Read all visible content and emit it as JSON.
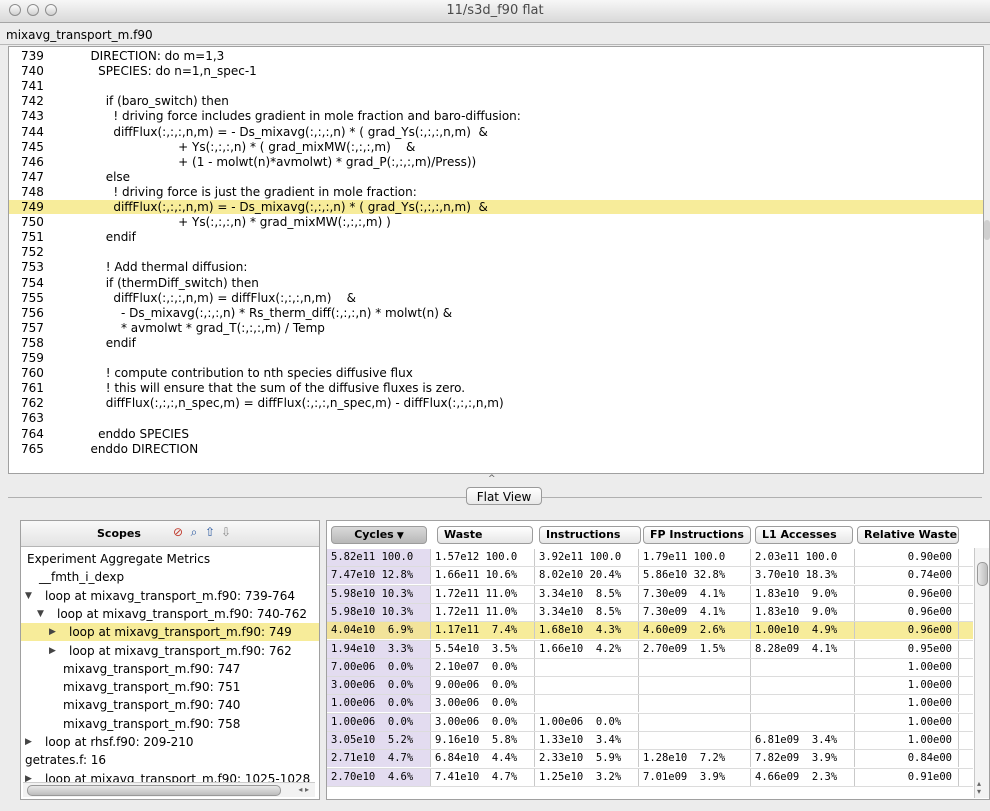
{
  "window": {
    "title": "11/s3d_f90 flat"
  },
  "source": {
    "file_name": "mixavg_transport_m.f90",
    "lines": [
      {
        "num": "739",
        "code": "   DIRECTION: do m=1,3"
      },
      {
        "num": "740",
        "code": "     SPECIES: do n=1,n_spec-1"
      },
      {
        "num": "741",
        "code": ""
      },
      {
        "num": "742",
        "code": "       if (baro_switch) then"
      },
      {
        "num": "743",
        "code": "         ! driving force includes gradient in mole fraction and baro-diffusion:"
      },
      {
        "num": "744",
        "code": "         diffFlux(:,:,:,n,m) = - Ds_mixavg(:,:,:,n) * ( grad_Ys(:,:,:,n,m)  &"
      },
      {
        "num": "745",
        "code": "                          + Ys(:,:,:,n) * ( grad_mixMW(:,:,:,m)    &"
      },
      {
        "num": "746",
        "code": "                          + (1 - molwt(n)*avmolwt) * grad_P(:,:,:,m)/Press))"
      },
      {
        "num": "747",
        "code": "       else"
      },
      {
        "num": "748",
        "code": "         ! driving force is just the gradient in mole fraction:"
      },
      {
        "num": "749",
        "code": "         diffFlux(:,:,:,n,m) = - Ds_mixavg(:,:,:,n) * ( grad_Ys(:,:,:,n,m)  &"
      },
      {
        "num": "750",
        "code": "                          + Ys(:,:,:,n) * grad_mixMW(:,:,:,m) )"
      },
      {
        "num": "751",
        "code": "       endif"
      },
      {
        "num": "752",
        "code": ""
      },
      {
        "num": "753",
        "code": "       ! Add thermal diffusion:"
      },
      {
        "num": "754",
        "code": "       if (thermDiff_switch) then"
      },
      {
        "num": "755",
        "code": "         diffFlux(:,:,:,n,m) = diffFlux(:,:,:,n,m)    &"
      },
      {
        "num": "756",
        "code": "           - Ds_mixavg(:,:,:,n) * Rs_therm_diff(:,:,:,n) * molwt(n) &"
      },
      {
        "num": "757",
        "code": "           * avmolwt * grad_T(:,:,:,m) / Temp"
      },
      {
        "num": "758",
        "code": "       endif"
      },
      {
        "num": "759",
        "code": ""
      },
      {
        "num": "760",
        "code": "       ! compute contribution to nth species diffusive flux"
      },
      {
        "num": "761",
        "code": "       ! this will ensure that the sum of the diffusive fluxes is zero."
      },
      {
        "num": "762",
        "code": "       diffFlux(:,:,:,n_spec,m) = diffFlux(:,:,:,n_spec,m) - diffFlux(:,:,:,n,m)"
      },
      {
        "num": "763",
        "code": ""
      },
      {
        "num": "764",
        "code": "     enddo SPECIES"
      },
      {
        "num": "765",
        "code": "   enddo DIRECTION"
      }
    ],
    "highlighted_line": "749"
  },
  "tab": {
    "label": "Flat View"
  },
  "scopes": {
    "header": "Scopes",
    "rows": [
      {
        "label": "Experiment Aggregate Metrics",
        "tri": ""
      },
      {
        "label": "__fmth_i_dexp",
        "tri": ""
      },
      {
        "label": "loop at mixavg_transport_m.f90: 739-764",
        "tri": "▼"
      },
      {
        "label": "loop at mixavg_transport_m.f90: 740-762",
        "tri": "▼"
      },
      {
        "label": "loop at mixavg_transport_m.f90: 749",
        "tri": "▶"
      },
      {
        "label": "loop at mixavg_transport_m.f90: 762",
        "tri": "▶"
      },
      {
        "label": "mixavg_transport_m.f90: 747",
        "tri": ""
      },
      {
        "label": "mixavg_transport_m.f90: 751",
        "tri": ""
      },
      {
        "label": "mixavg_transport_m.f90: 740",
        "tri": ""
      },
      {
        "label": "mixavg_transport_m.f90: 758",
        "tri": ""
      },
      {
        "label": "loop at rhsf.f90: 209-210",
        "tri": "▶"
      },
      {
        "label": "getrates.f: 16",
        "tri": ""
      },
      {
        "label": "loop at mixavg_transport_m.f90: 1025-1028",
        "tri": "▶"
      }
    ]
  },
  "metrics": {
    "columns": [
      "Cycles",
      "Waste",
      "Instructions",
      "FP Instructions",
      "L1 Accesses",
      "Relative Waste"
    ],
    "sort_indicator": "▼",
    "rows": [
      [
        "5.82e11 100.0",
        "1.57e12 100.0",
        "3.92e11 100.0",
        "1.79e11 100.0",
        "2.03e11 100.0",
        "0.90e00"
      ],
      [
        "7.47e10 12.8%",
        "1.66e11 10.6%",
        "8.02e10 20.4%",
        "5.86e10 32.8%",
        "3.70e10 18.3%",
        "0.74e00"
      ],
      [
        "5.98e10 10.3%",
        "1.72e11 11.0%",
        "3.34e10  8.5%",
        "7.30e09  4.1%",
        "1.83e10  9.0%",
        "0.96e00"
      ],
      [
        "5.98e10 10.3%",
        "1.72e11 11.0%",
        "3.34e10  8.5%",
        "7.30e09  4.1%",
        "1.83e10  9.0%",
        "0.96e00"
      ],
      [
        "4.04e10  6.9%",
        "1.17e11  7.4%",
        "1.68e10  4.3%",
        "4.60e09  2.6%",
        "1.00e10  4.9%",
        "0.96e00"
      ],
      [
        "1.94e10  3.3%",
        "5.54e10  3.5%",
        "1.66e10  4.2%",
        "2.70e09  1.5%",
        "8.28e09  4.1%",
        "0.95e00"
      ],
      [
        "7.00e06  0.0%",
        "2.10e07  0.0%",
        "",
        "",
        "",
        "1.00e00"
      ],
      [
        "3.00e06  0.0%",
        "9.00e06  0.0%",
        "",
        "",
        "",
        "1.00e00"
      ],
      [
        "1.00e06  0.0%",
        "3.00e06  0.0%",
        "",
        "",
        "",
        "1.00e00"
      ],
      [
        "1.00e06  0.0%",
        "3.00e06  0.0%",
        "1.00e06  0.0%",
        "",
        "",
        "1.00e00"
      ],
      [
        "3.05e10  5.2%",
        "9.16e10  5.8%",
        "1.33e10  3.4%",
        "",
        "6.81e09  3.4%",
        "1.00e00"
      ],
      [
        "2.71e10  4.7%",
        "6.84e10  4.4%",
        "2.33e10  5.9%",
        "1.28e10  7.2%",
        "7.82e09  3.9%",
        "0.84e00"
      ],
      [
        "2.70e10  4.6%",
        "7.41e10  4.7%",
        "1.25e10  3.2%",
        "7.01e09  3.9%",
        "4.66e09  2.3%",
        "0.91e00"
      ]
    ]
  },
  "icons": {
    "scope_tools": [
      "zoom-out-icon",
      "zoom-in-icon",
      "move-up-icon",
      "move-down-icon"
    ],
    "accent_highlight": "#f7ec9a",
    "cycles_column_tint": "#e3dcf0"
  }
}
